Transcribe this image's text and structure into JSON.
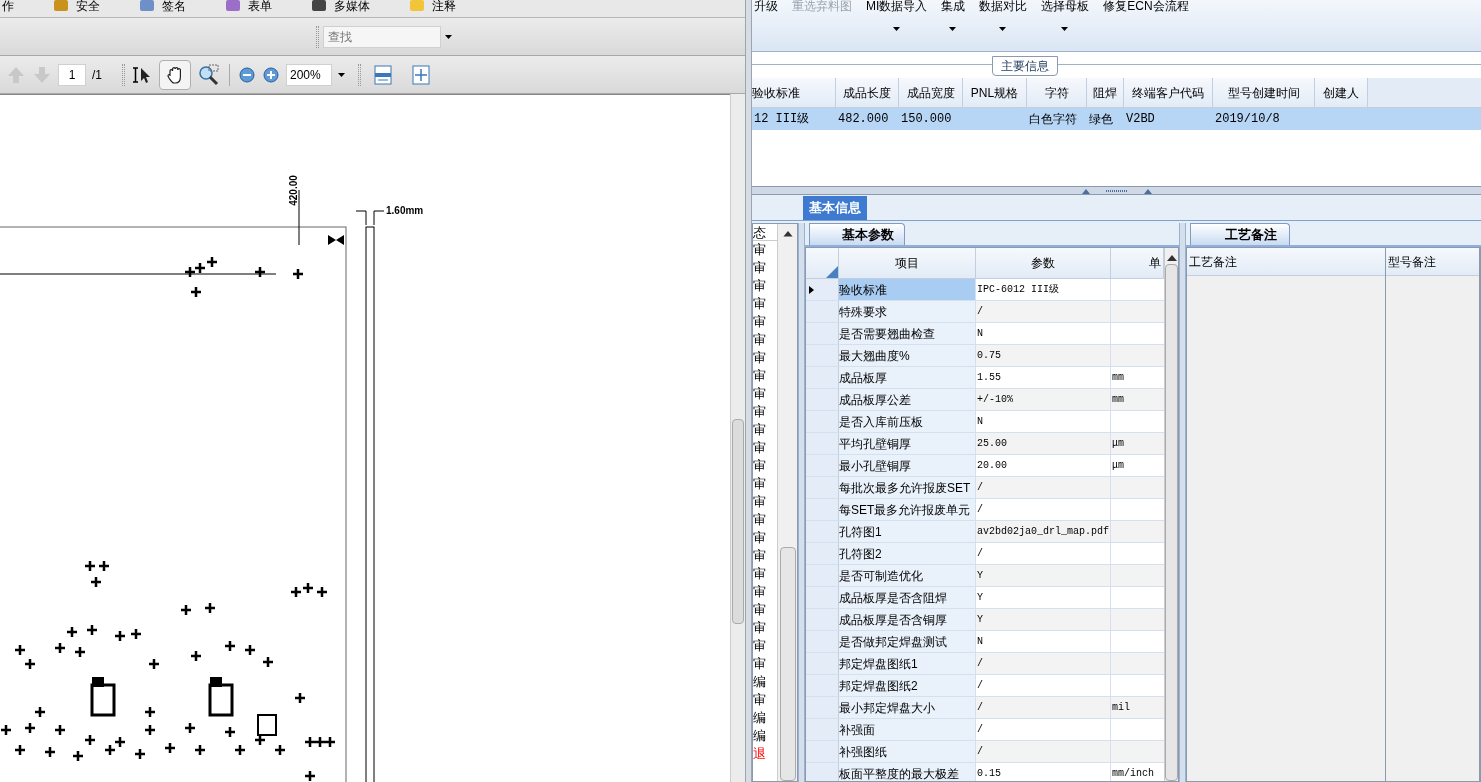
{
  "pdf_viewer": {
    "menu": [
      "作",
      "安全",
      "签名",
      "表单",
      "多媒体",
      "注释"
    ],
    "find": {
      "placeholder": "查找"
    },
    "page": {
      "value": "1"
    },
    "page_total": "/1",
    "zoom": "200%",
    "hand_tool": {
      "selected": true
    },
    "drawing_labels": [
      "420.00",
      "1.60mm"
    ]
  },
  "ribbon": {
    "buttons": [
      {
        "label": "升级",
        "disabled": false,
        "dropdown": false
      },
      {
        "label": "重选弃料图",
        "disabled": true,
        "dropdown": false
      },
      {
        "label": "MI数据导入",
        "disabled": false,
        "dropdown": true
      },
      {
        "label": "集成",
        "disabled": false,
        "dropdown": true
      },
      {
        "label": "数据对比",
        "disabled": false,
        "dropdown": true
      },
      {
        "label": "选择母板",
        "disabled": false,
        "dropdown": true
      },
      {
        "label": "修复ECN会流程",
        "disabled": false,
        "dropdown": false
      }
    ]
  },
  "main_info": {
    "title": "主要信息",
    "columns": [
      "验收标准",
      "成品长度",
      "成品宽度",
      "PNL规格",
      "字符",
      "阻焊",
      "终端客户代码",
      "型号创建时间",
      "创建人"
    ],
    "rows": [
      {
        "selected": true,
        "cells": [
          "12 III级",
          "482.000",
          "150.000",
          "",
          "白色字符",
          "绿色",
          "V2BD",
          "2019/10/8",
          ""
        ]
      }
    ]
  },
  "detail": {
    "tab": {
      "label": "基本信息",
      "selected": true
    },
    "status_list": {
      "header": "态",
      "items": [
        {
          "text": "审",
          "kind": "normal"
        },
        {
          "text": "审",
          "kind": "normal"
        },
        {
          "text": "审",
          "kind": "normal"
        },
        {
          "text": "审",
          "kind": "normal"
        },
        {
          "text": "审",
          "kind": "normal"
        },
        {
          "text": "审",
          "kind": "normal"
        },
        {
          "text": "审",
          "kind": "normal"
        },
        {
          "text": "审",
          "kind": "normal"
        },
        {
          "text": "审",
          "kind": "normal"
        },
        {
          "text": "审",
          "kind": "normal"
        },
        {
          "text": "审",
          "kind": "normal"
        },
        {
          "text": "审",
          "kind": "normal"
        },
        {
          "text": "审",
          "kind": "normal"
        },
        {
          "text": "审",
          "kind": "normal"
        },
        {
          "text": "审",
          "kind": "normal"
        },
        {
          "text": "审",
          "kind": "normal"
        },
        {
          "text": "审",
          "kind": "normal"
        },
        {
          "text": "审",
          "kind": "normal"
        },
        {
          "text": "审",
          "kind": "normal"
        },
        {
          "text": "审",
          "kind": "normal"
        },
        {
          "text": "审",
          "kind": "normal"
        },
        {
          "text": "审",
          "kind": "normal"
        },
        {
          "text": "审",
          "kind": "normal"
        },
        {
          "text": "审",
          "kind": "normal"
        },
        {
          "text": "编",
          "kind": "normal"
        },
        {
          "text": "审",
          "kind": "normal"
        },
        {
          "text": "编",
          "kind": "normal"
        },
        {
          "text": "编",
          "kind": "normal"
        },
        {
          "text": "退",
          "kind": "alert"
        }
      ]
    },
    "params": {
      "tab": {
        "label": "基本参数",
        "selected": true
      },
      "columns": [
        "项目",
        "参数",
        "单"
      ],
      "rows": [
        {
          "item": "验收标准",
          "value": "IPC-6012 III级",
          "unit": "",
          "selected": true
        },
        {
          "item": "特殊要求",
          "value": "/",
          "unit": "",
          "selected": false
        },
        {
          "item": "是否需要翘曲检查",
          "value": "N",
          "unit": "",
          "selected": false
        },
        {
          "item": "最大翘曲度%",
          "value": "0.75",
          "unit": "",
          "selected": false
        },
        {
          "item": "成品板厚",
          "value": "1.55",
          "unit": "mm",
          "selected": false
        },
        {
          "item": "成品板厚公差",
          "value": "+/-10%",
          "unit": "mm",
          "selected": false
        },
        {
          "item": "是否入库前压板",
          "value": "N",
          "unit": "",
          "selected": false
        },
        {
          "item": "平均孔壁铜厚",
          "value": "25.00",
          "unit": "μm",
          "selected": false
        },
        {
          "item": "最小孔壁铜厚",
          "value": "20.00",
          "unit": "μm",
          "selected": false
        },
        {
          "item": "每批次最多允许报废SET",
          "value": "/",
          "unit": "",
          "selected": false
        },
        {
          "item": "每SET最多允许报废单元",
          "value": "/",
          "unit": "",
          "selected": false
        },
        {
          "item": "孔符图1",
          "value": "av2bd02ja0_drl_map.pdf",
          "unit": "",
          "selected": false
        },
        {
          "item": "孔符图2",
          "value": "/",
          "unit": "",
          "selected": false
        },
        {
          "item": "是否可制造优化",
          "value": "Y",
          "unit": "",
          "selected": false
        },
        {
          "item": "成品板厚是否含阻焊",
          "value": "Y",
          "unit": "",
          "selected": false
        },
        {
          "item": "成品板厚是否含铜厚",
          "value": "Y",
          "unit": "",
          "selected": false
        },
        {
          "item": "是否做邦定焊盘测试",
          "value": "N",
          "unit": "",
          "selected": false
        },
        {
          "item": "邦定焊盘图纸1",
          "value": "/",
          "unit": "",
          "selected": false
        },
        {
          "item": "邦定焊盘图纸2",
          "value": "/",
          "unit": "",
          "selected": false
        },
        {
          "item": "最小邦定焊盘大小",
          "value": "/",
          "unit": "mil",
          "selected": false
        },
        {
          "item": "补强面",
          "value": "/",
          "unit": "",
          "selected": false
        },
        {
          "item": "补强图纸",
          "value": "/",
          "unit": "",
          "selected": false
        },
        {
          "item": "板面平整度的最大极差",
          "value": "0.15",
          "unit": "mm/inch",
          "selected": false
        }
      ]
    },
    "notes": {
      "tab": {
        "label": "工艺备注",
        "selected": true
      },
      "columns": [
        "工艺备注",
        "型号备注"
      ]
    }
  }
}
